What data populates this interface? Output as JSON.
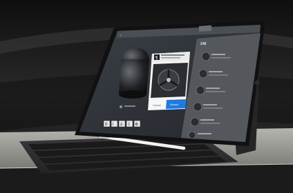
{
  "app": {
    "nav_title": "",
    "nav_back_label": "",
    "side_count": "248"
  },
  "dialog": {
    "cancel_label": "Cancel",
    "submit_label": "Submit"
  },
  "list": {
    "items": [
      {
        "title": "",
        "subtitle": ""
      },
      {
        "title": "",
        "subtitle": ""
      },
      {
        "title": "",
        "subtitle": ""
      },
      {
        "title": "",
        "subtitle": ""
      },
      {
        "title": "",
        "subtitle": ""
      },
      {
        "title": "",
        "subtitle": ""
      }
    ]
  },
  "toolbar": {
    "buttons": [
      "search-icon",
      "info-icon",
      "person-icon",
      "share-icon",
      "settings-icon"
    ]
  },
  "colors": {
    "background_dark": "#1a1a1a",
    "tablet_frame": "#151515",
    "screen_dark": "#2e3238",
    "panel_right": "#5a5e63",
    "accent_blue": "#1e7be0",
    "keyboard": "#2f2f31",
    "ledge_concrete": "#9a9a96",
    "pencil": "#eeeeee"
  }
}
